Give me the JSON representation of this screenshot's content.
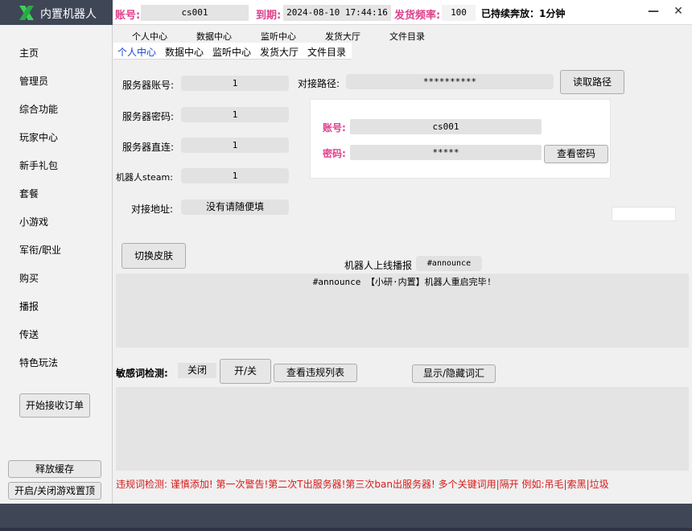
{
  "app": {
    "title": "内置机器人"
  },
  "header": {
    "account_label": "账号:",
    "account_value": "cs001",
    "expire_label": "到期:",
    "expire_value": "2024-08-10 17:44:16",
    "freq_label": "发货频率:",
    "freq_value": "100",
    "status": "已持续奔放：1分钟",
    "minimize": "—",
    "close": "✕"
  },
  "sidebar": {
    "items": [
      "主页",
      "管理员",
      "综合功能",
      "玩家中心",
      "新手礼包",
      "套餐",
      "小游戏",
      "军衔/职业",
      "购买",
      "播报",
      "传送",
      "特色玩法"
    ],
    "start_orders": "开始接收订单",
    "release_cache": "释放缓存",
    "toggle_top": "开启/关闭游戏置顶"
  },
  "tabs_upper": [
    "个人中心",
    "数据中心",
    "监听中心",
    "发货大厅",
    "文件目录"
  ],
  "tabs": [
    "个人中心",
    "数据中心",
    "监听中心",
    "发货大厅",
    "文件目录"
  ],
  "form": {
    "server_account_label": "服务器账号:",
    "server_account_value": "1",
    "server_password_label": "服务器密码:",
    "server_password_value": "1",
    "server_direct_label": "服务器直连:",
    "server_direct_value": "1",
    "robot_steam_label": "机器人steam:",
    "robot_steam_value": "1",
    "connect_addr_label": "对接地址:",
    "connect_addr_value": "没有请随便填",
    "connect_path_label": "对接路径:",
    "connect_path_value": "**********",
    "read_path_btn": "读取路径"
  },
  "account_box": {
    "account_label": "账号:",
    "account_value": "cs001",
    "password_label": "密码:",
    "password_value": "*****",
    "view_password_btn": "查看密码"
  },
  "skin_btn": "切换皮肤",
  "broadcast": {
    "label": "机器人上线播报",
    "value": "#announce",
    "message": "#announce 【小研·内置】机器人重启完毕!"
  },
  "sensitive": {
    "label": "敏感词检测:",
    "state": "关闭",
    "toggle_btn": "开/关",
    "view_list_btn": "查看违规列表",
    "show_hide_btn": "显示/隐藏词汇"
  },
  "warning_text": "违规词检测: 谨慎添加! 第一次警告!第二次T出服务器!第三次ban出服务器!  多个关键词用|隔开 例如:吊毛|索黑|垃圾"
}
